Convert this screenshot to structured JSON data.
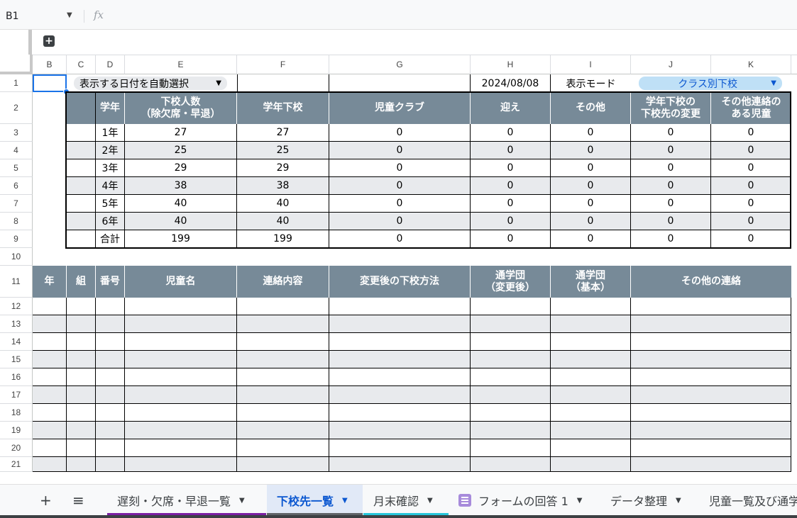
{
  "formula_bar": {
    "name_box": "B1",
    "fx_label": "fx",
    "formula": ""
  },
  "columns": [
    "B",
    "C",
    "D",
    "E",
    "F",
    "G",
    "H",
    "I",
    "J",
    "K"
  ],
  "rows": [
    "1",
    "2",
    "3",
    "4",
    "5",
    "6",
    "7",
    "8",
    "9",
    "10",
    "11",
    "12",
    "13",
    "14",
    "15",
    "16",
    "17",
    "18",
    "19",
    "20",
    "21"
  ],
  "row1": {
    "date_select": "表示する日付を自動選択",
    "date_value": "2024/08/08",
    "mode_label": "表示モード",
    "mode_select": "クラス別下校"
  },
  "summary_headers": [
    "",
    "学年",
    "下校人数\n（除欠席・早退）",
    "学年下校",
    "児童クラブ",
    "迎え",
    "その他",
    "学年下校の\n下校先の変更",
    "その他連絡の\nある児童"
  ],
  "summary_rows": [
    [
      "1年",
      "27",
      "27",
      "0",
      "0",
      "0",
      "0",
      "0"
    ],
    [
      "2年",
      "25",
      "25",
      "0",
      "0",
      "0",
      "0",
      "0"
    ],
    [
      "3年",
      "29",
      "29",
      "0",
      "0",
      "0",
      "0",
      "0"
    ],
    [
      "4年",
      "38",
      "38",
      "0",
      "0",
      "0",
      "0",
      "0"
    ],
    [
      "5年",
      "40",
      "40",
      "0",
      "0",
      "0",
      "0",
      "0"
    ],
    [
      "6年",
      "40",
      "40",
      "0",
      "0",
      "0",
      "0",
      "0"
    ],
    [
      "合計",
      "199",
      "199",
      "0",
      "0",
      "0",
      "0",
      "0"
    ]
  ],
  "detail_headers": [
    "年",
    "組",
    "番号",
    "児童名",
    "連絡内容",
    "変更後の下校方法",
    "通学団\n（変更後）",
    "通学団\n（基本）",
    "その他の連絡"
  ],
  "tabs": {
    "add": "+",
    "all_sheets": "≡",
    "items": [
      {
        "label": "遅刻・欠席・早退一覧",
        "color": "#7b1fa2"
      },
      {
        "label": "下校先一覧",
        "color": "#5f6368",
        "active": true
      },
      {
        "label": "月末確認",
        "color": "#26c6da"
      },
      {
        "label": "フォームの回答 1",
        "color": ""
      },
      {
        "label": "データ整理",
        "color": ""
      },
      {
        "label": "児童一覧及び通学",
        "color": ""
      }
    ]
  },
  "colors": {
    "header_bg": "#778a98",
    "stripe": "#e8eaed",
    "chip_blue": "#bfe0f6",
    "active_tab": "#0b57d0"
  }
}
